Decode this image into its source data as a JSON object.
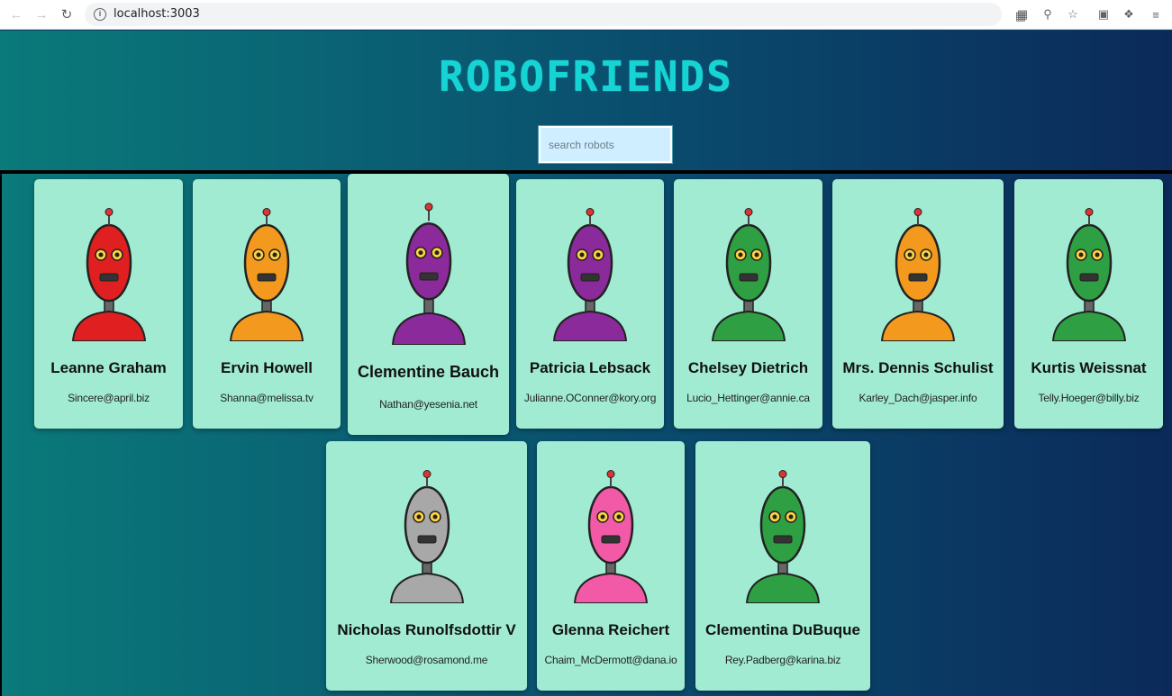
{
  "browser": {
    "url": "localhost:3003"
  },
  "app": {
    "title": "ROBOFRIENDS",
    "search_placeholder": "search robots"
  },
  "robots": [
    {
      "name": "Leanne Graham",
      "email": "Sincere@april.biz",
      "color": "#e02020"
    },
    {
      "name": "Ervin Howell",
      "email": "Shanna@melissa.tv",
      "color": "#f39a1e"
    },
    {
      "name": "Clementine Bauch",
      "email": "Nathan@yesenia.net",
      "color": "#8b2a9a"
    },
    {
      "name": "Patricia Lebsack",
      "email": "Julianne.OConner@kory.org",
      "color": "#8b2a9a"
    },
    {
      "name": "Chelsey Dietrich",
      "email": "Lucio_Hettinger@annie.ca",
      "color": "#2ea043"
    },
    {
      "name": "Mrs. Dennis Schulist",
      "email": "Karley_Dach@jasper.info",
      "color": "#f39a1e"
    },
    {
      "name": "Kurtis Weissnat",
      "email": "Telly.Hoeger@billy.biz",
      "color": "#2ea043"
    },
    {
      "name": "Nicholas Runolfsdottir V",
      "email": "Sherwood@rosamond.me",
      "color": "#a8a8a8"
    },
    {
      "name": "Glenna Reichert",
      "email": "Chaim_McDermott@dana.io",
      "color": "#f25aa8"
    },
    {
      "name": "Clementina DuBuque",
      "email": "Rey.Padberg@karina.biz",
      "color": "#2ea043"
    }
  ]
}
